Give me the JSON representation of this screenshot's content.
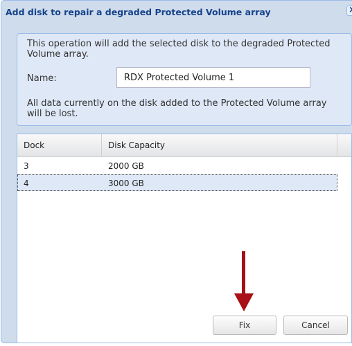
{
  "dialog": {
    "title": "Add disk to repair a degraded Protected Volume array",
    "close_glyph": "×"
  },
  "form": {
    "info_text": "This operation will add the selected disk to the degraded Protected Volume array.",
    "name_label": "Name:",
    "name_value": "RDX Protected Volume 1",
    "warning_text": "All data currently on the disk added to the Protected Volume array will be lost."
  },
  "grid": {
    "columns": [
      "Dock",
      "Disk Capacity"
    ],
    "rows": [
      {
        "dock": "3",
        "capacity": "2000 GB",
        "selected": false
      },
      {
        "dock": "4",
        "capacity": "3000 GB",
        "selected": true
      }
    ]
  },
  "buttons": {
    "fix_label": "Fix",
    "cancel_label": "Cancel"
  },
  "annotation": {
    "arrow_color": "#a80f17",
    "arrow_icon": "down-arrow-icon"
  }
}
